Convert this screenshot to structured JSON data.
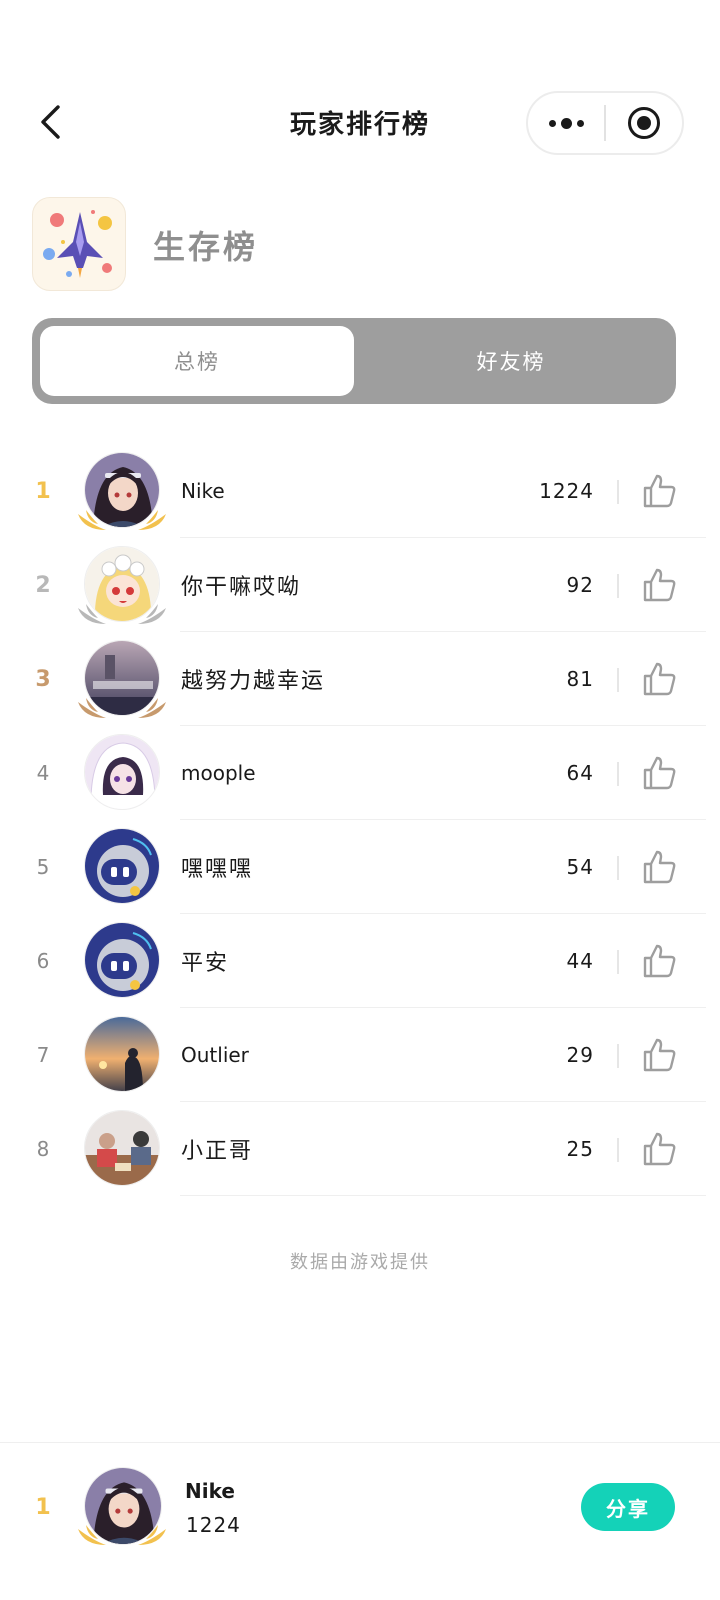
{
  "header": {
    "title": "玩家排行榜"
  },
  "game": {
    "name": "生存榜"
  },
  "tabs": [
    {
      "label": "总榜",
      "active": true
    },
    {
      "label": "好友榜",
      "active": false
    }
  ],
  "ranking": [
    {
      "rank": "1",
      "name": "Nike",
      "score": "1224",
      "medal": "gold",
      "avatar": "anime-girl-headband"
    },
    {
      "rank": "2",
      "name": "你干嘛哎呦",
      "score": "92",
      "medal": "silver",
      "avatar": "chibi-girl-flowers"
    },
    {
      "rank": "3",
      "name": "越努力越幸运",
      "score": "81",
      "medal": "bronze",
      "avatar": "text-photo"
    },
    {
      "rank": "4",
      "name": "moople",
      "score": "64",
      "medal": "",
      "avatar": "anime-girl-hood"
    },
    {
      "rank": "5",
      "name": "嘿嘿嘿",
      "score": "54",
      "medal": "",
      "avatar": "robot-default"
    },
    {
      "rank": "6",
      "name": "平安",
      "score": "44",
      "medal": "",
      "avatar": "robot-default"
    },
    {
      "rank": "7",
      "name": "Outlier",
      "score": "29",
      "medal": "",
      "avatar": "sunset-person"
    },
    {
      "rank": "8",
      "name": "小正哥",
      "score": "25",
      "medal": "",
      "avatar": "family-photo"
    }
  ],
  "footer_note": "数据由游戏提供",
  "my_rank": {
    "rank": "1",
    "name": "Nike",
    "score": "1224",
    "share_label": "分享"
  },
  "colors": {
    "gold": "#f2c14e",
    "silver": "#b8b8b8",
    "bronze": "#c79a6d",
    "share": "#14d2b8",
    "tab_bg": "#9e9e9e"
  }
}
